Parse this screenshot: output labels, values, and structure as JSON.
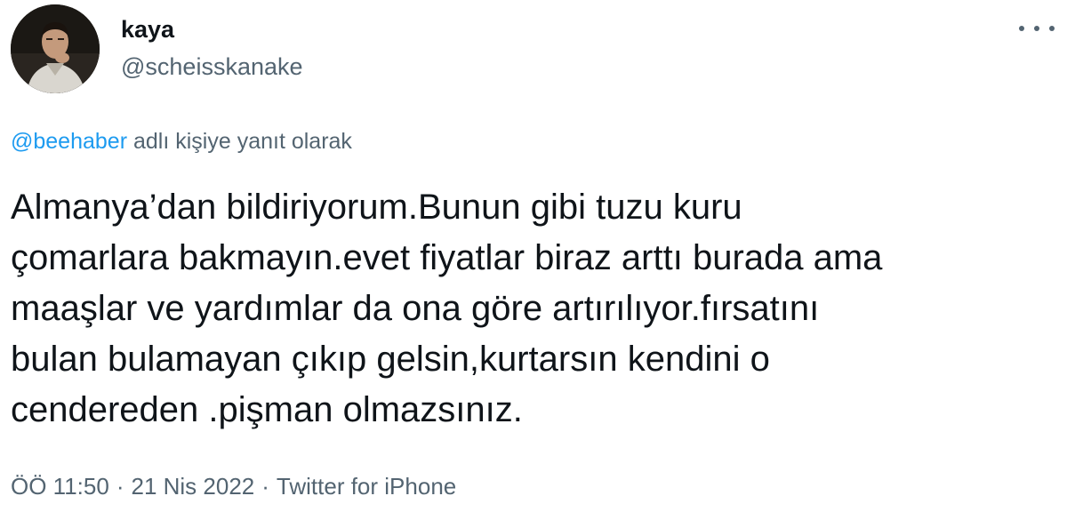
{
  "user": {
    "display_name": "kaya",
    "handle": "@scheisskanake"
  },
  "reply": {
    "mention": "@beehaber",
    "suffix": " adlı kişiye yanıt olarak"
  },
  "tweet": {
    "lines": [
      "Almanya’dan bildiriyorum.Bunun gibi tuzu kuru",
      "çomarlara bakmayın.evet fiyatlar biraz arttı burada ama",
      "maaşlar ve yardımlar da ona göre artırılıyor.fırsatını",
      "bulan bulamayan çıkıp gelsin,kurtarsın kendini o",
      "cendereden .pişman olmazsınız."
    ]
  },
  "meta": {
    "time": "ÖÖ 11:50",
    "separator": "·",
    "date": "21 Nis 2022",
    "source": "Twitter for iPhone"
  },
  "icons": {
    "more": "more-horizontal-icon",
    "avatar": "user-avatar"
  },
  "colors": {
    "text_primary": "#0f1419",
    "text_secondary": "#536471",
    "link": "#1d9bf0"
  }
}
